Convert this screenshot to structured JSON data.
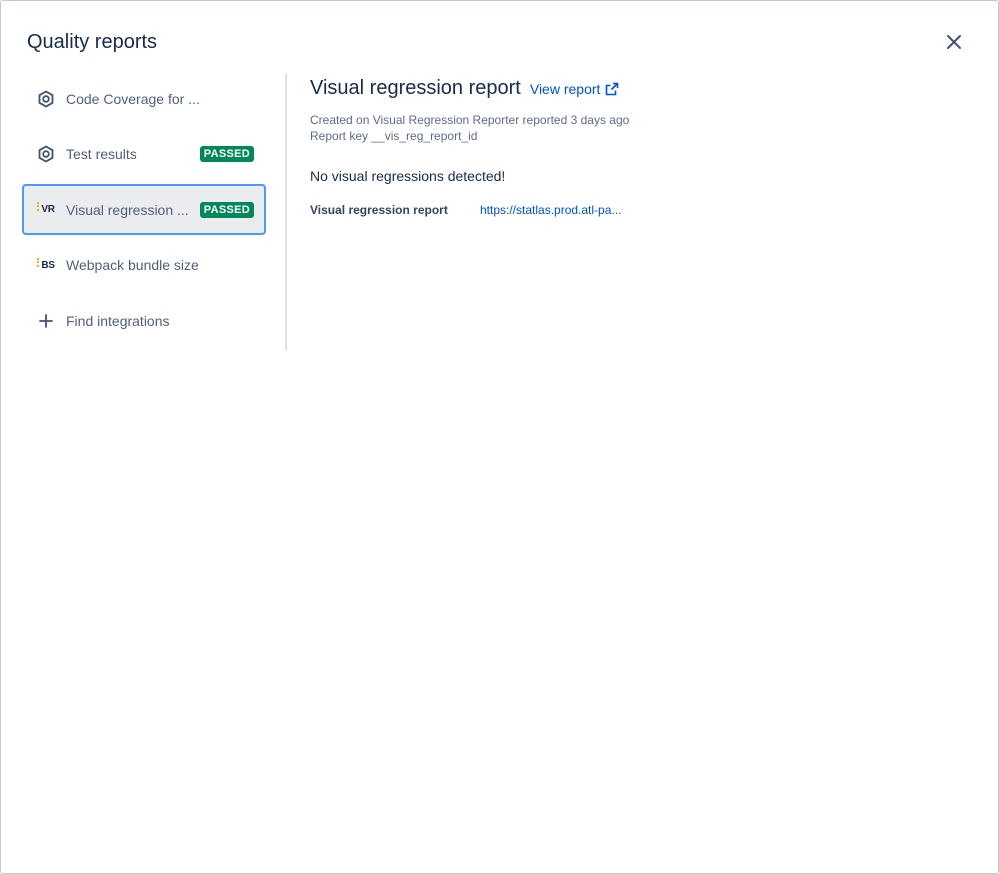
{
  "modal": {
    "title": "Quality reports",
    "close_icon": "close-icon"
  },
  "sidebar": {
    "items": [
      {
        "label": "Code Coverage for ...",
        "icon": "hexagon-report-icon",
        "badge": "",
        "active": false
      },
      {
        "label": "Test results",
        "icon": "hexagon-report-icon",
        "badge": "PASSED",
        "active": false
      },
      {
        "label": "Visual regression ...",
        "icon": "vr-logo-icon",
        "icon_text": "VR",
        "badge": "PASSED",
        "active": true
      },
      {
        "label": "Webpack bundle size",
        "icon": "bs-logo-icon",
        "icon_text": "BS",
        "badge": "",
        "active": false
      },
      {
        "label": "Find integrations",
        "icon": "plus-icon",
        "badge": "",
        "active": false
      }
    ]
  },
  "report": {
    "title": "Visual regression report",
    "view_report_label": "View report",
    "created_line": "Created on Visual Regression Reporter reported 3 days ago",
    "report_key_line": "Report key __vis_reg_report_id",
    "message": "No visual regressions detected!",
    "detail_key": "Visual regression report",
    "detail_value": "https://statlas.prod.atl-pa..."
  },
  "colors": {
    "accent_link": "#0052cc",
    "passed_badge": "#00875a",
    "active_border": "#4c9aff",
    "active_bg": "#ebecf0"
  }
}
